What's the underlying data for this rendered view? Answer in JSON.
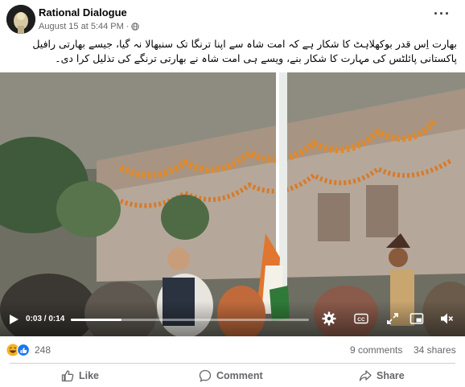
{
  "post": {
    "author": "Rational Dialogue",
    "date": "August 15 at 5:44 PM",
    "meta_separator": "·",
    "more_icon": "more-horizontal-icon",
    "privacy_icon": "globe-icon",
    "caption": "بھارت اِس قدر بوکھلاہٹ کا شکار ہے کہ امت شاہ سے اپنا ترنگا تک سنبھالا نہ گیا، جیسے بھارتی رافیل پاکستانی پائلٹس کی مہارت کا شکار بنے، ویسے ہی امت شاہ نے بھارتی ترنگے کی تذلیل کرا دی۔"
  },
  "video": {
    "time": "0:03 / 0:14",
    "progress": 0.2143,
    "icons": [
      "play-icon",
      "settings-icon",
      "captions-icon",
      "fullscreen-icon",
      "miniplayer-icon",
      "volume-icon"
    ],
    "captions_label": "CC"
  },
  "reactions": {
    "count": "248",
    "icons": [
      "haha-reaction-icon",
      "like-reaction-icon"
    ],
    "comments": "9 comments",
    "shares": "34 shares"
  },
  "actions": {
    "like": "Like",
    "comment": "Comment",
    "share": "Share"
  },
  "colors": {
    "meta_text": "#65676b",
    "like_blue": "#1877f2",
    "haha_yellow": "#f7b125",
    "divider": "#ced0d4"
  }
}
